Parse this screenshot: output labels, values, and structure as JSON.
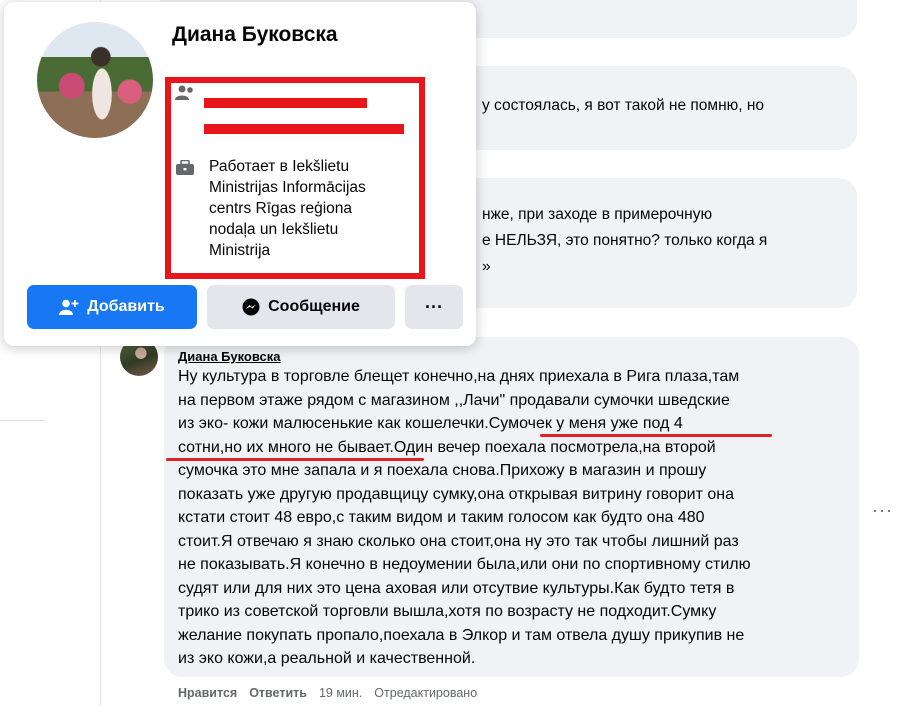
{
  "hover_card": {
    "name": "Диана Буковска",
    "work_lines": [
      "Работает в Iekšlietu",
      "Ministrijas Informācijas",
      "centrs Rīgas reģiona",
      "nodaļa un Iekšlietu",
      "Ministrija"
    ],
    "add_button": "Добавить",
    "message_button": "Сообщение",
    "more_button": "···"
  },
  "background_comments": {
    "c2_text": "у состоялась, я вот такой не помню, но",
    "c3_lines": [
      "нже, при заходе в примерочную",
      "е НЕЛЬЗЯ, это понятно? только когда я",
      "»"
    ]
  },
  "comment": {
    "author": "Диана Буковска",
    "lines": [
      "Ну культура в торговле блещет конечно,на днях приехала в Рига плаза,там",
      "на первом этаже рядом с магазином ,,Лачи\" продавали сумочки шведские",
      "из эко- кожи малюсенькие как кошелечки.Сумочек у меня уже под 4",
      "сотни,но их много не бывает.Один вечер поехала посмотрела,на второй",
      "сумочка это мне запала и я поехала снова.Прихожу в магазин и прошу",
      "показать уже другую продавщицу сумку,она открывая витрину говорит она",
      "кстати стоит 48 евро,с таким видом и таким голосом как будто она 480",
      "стоит.Я отвечаю я знаю сколько она стоит,она ну это так чтобы лишний раз",
      "не показывать.Я конечно в недоумении была,или они по спортивному стилю",
      "судят или для них это цена аховая или отсутвие культуры.Как будто тетя в",
      "трико из советской торговли вышла,хотя по возрасту не подходит.Сумку",
      "желание покупать пропало,поехала в Элкор и там отвела душу прикупив не",
      "из эко кожи,а реальной и качественной."
    ],
    "actions": {
      "like": "Нравится",
      "reply": "Ответить",
      "time": "19 мин.",
      "edited": "Отредактировано"
    },
    "more_options": "···"
  },
  "colors": {
    "accent": "#1877f2",
    "highlight": "#e8161a",
    "bubble": "#f0f2f5"
  },
  "icons": [
    "person-add-icon",
    "messenger-icon",
    "briefcase-icon",
    "friends-icon",
    "more-icon"
  ]
}
